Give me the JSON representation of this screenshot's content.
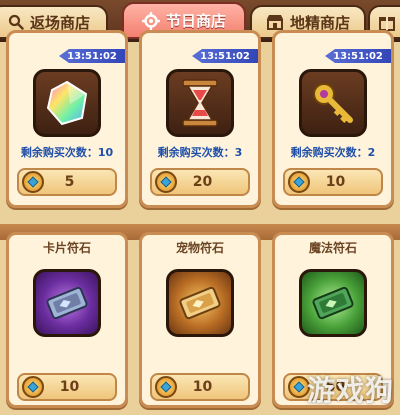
{
  "tabs": [
    {
      "label": "返场商店",
      "icon": "search-icon",
      "active": false
    },
    {
      "label": "节日商店",
      "icon": "settings-gear-icon",
      "active": true
    },
    {
      "label": "地精商店",
      "icon": "shop-icon",
      "active": false
    },
    {
      "label": "",
      "icon": "gift-icon",
      "active": false
    }
  ],
  "items": [
    {
      "name": "",
      "timer": "13:51:02",
      "icon": "rainbow-crystal-icon",
      "remaining": "剩余购买次数：10",
      "price": "5"
    },
    {
      "name": "",
      "timer": "13:51:02",
      "icon": "hourglass-icon",
      "remaining": "剩余购买次数：3",
      "price": "20"
    },
    {
      "name": "",
      "timer": "13:51:02",
      "icon": "golden-key-icon",
      "remaining": "剩余购买次数：2",
      "price": "10"
    },
    {
      "name": "卡片符石",
      "timer": "",
      "icon": "card-runestone-icon",
      "remaining": "",
      "price": "10"
    },
    {
      "name": "宠物符石",
      "timer": "",
      "icon": "pet-runestone-icon",
      "remaining": "",
      "price": "10"
    },
    {
      "name": "魔法符石",
      "timer": "",
      "icon": "magic-runestone-icon",
      "remaining": "",
      "price": "50"
    }
  ],
  "watermark": "游戏狗",
  "colors": {
    "active_tab": "#f3806f",
    "timer_badge": "#3246b8",
    "remaining_text": "#1f4fa8"
  }
}
